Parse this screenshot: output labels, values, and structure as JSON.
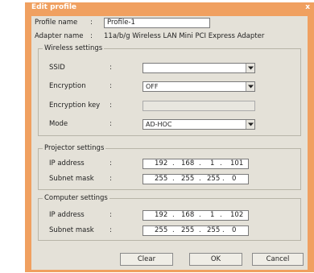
{
  "dialog": {
    "title": "Edit profile",
    "close": "x"
  },
  "profile": {
    "name_label": "Profile name",
    "name_colon": ":",
    "name_value": "Profile-1",
    "adapter_label": "Adapter name",
    "adapter_colon": ":",
    "adapter_value": "11a/b/g Wireless LAN Mini PCI Express Adapter"
  },
  "wireless": {
    "title": "Wireless settings",
    "ssid_label": "SSID",
    "ssid_value": "",
    "encryption_label": "Encryption",
    "encryption_value": "OFF",
    "key_label": "Encryption key",
    "key_value": "",
    "mode_label": "Mode",
    "mode_value": "AD-HOC",
    "colon": ":"
  },
  "projector": {
    "title": "Projector settings",
    "ip_label": "IP address",
    "ip": [
      "192",
      "168",
      "1",
      "101"
    ],
    "mask_label": "Subnet mask",
    "mask": [
      "255",
      "255",
      "255",
      "0"
    ],
    "colon": ":"
  },
  "computer": {
    "title": "Computer settings",
    "ip_label": "IP address",
    "ip": [
      "192",
      "168",
      "1",
      "102"
    ],
    "mask_label": "Subnet mask",
    "mask": [
      "255",
      "255",
      "255",
      "0"
    ],
    "colon": ":"
  },
  "ip_dot": ".",
  "buttons": {
    "clear": "Clear",
    "ok": "OK",
    "cancel": "Cancel"
  },
  "colors": {
    "title_bar": "#f0a060",
    "panel": "#e4e1d8"
  }
}
